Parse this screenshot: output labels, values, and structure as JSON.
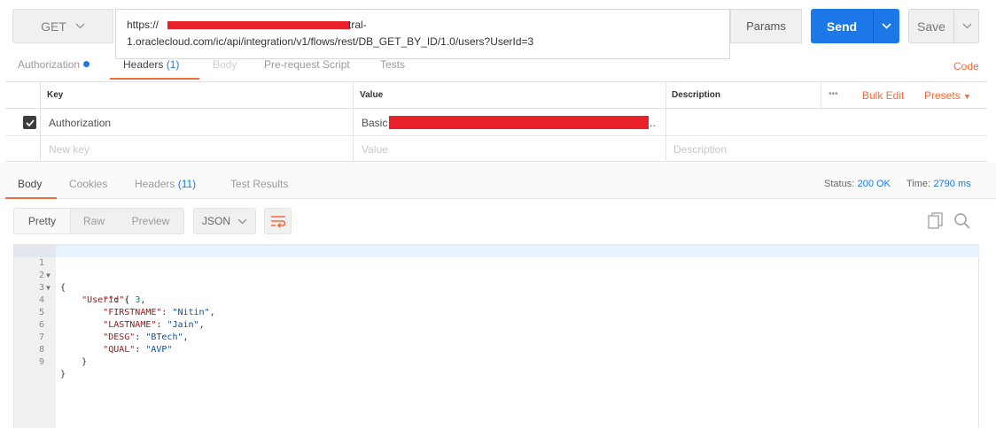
{
  "request": {
    "method": "GET",
    "url_line1_prefix": "https://",
    "url_line1_suffix": "tral-",
    "url_line2": "1.oraclecloud.com/ic/api/integration/v1/flows/rest/DB_GET_BY_ID/1.0/users?UserId=3",
    "params_label": "Params",
    "send_label": "Send",
    "save_label": "Save"
  },
  "request_tabs": {
    "authorization": "Authorization",
    "headers": "Headers",
    "headers_count": "(1)",
    "body": "Body",
    "prerequest": "Pre-request Script",
    "tests": "Tests",
    "code": "Code"
  },
  "headers_table": {
    "col_key": "Key",
    "col_value": "Value",
    "col_description": "Description",
    "more": "•••",
    "bulk_edit": "Bulk Edit",
    "presets": "Presets",
    "rows": [
      {
        "key": "Authorization",
        "value_prefix": "Basic",
        "value_suffix": "..",
        "description": ""
      }
    ],
    "placeholder_key": "New key",
    "placeholder_value": "Value",
    "placeholder_description": "Description"
  },
  "response_tabs": {
    "body": "Body",
    "cookies": "Cookies",
    "headers": "Headers",
    "headers_count": "(11)",
    "test_results": "Test Results",
    "status_label": "Status:",
    "status_value": "200 OK",
    "time_label": "Time:",
    "time_value": "2790 ms"
  },
  "response_toolbar": {
    "pretty": "Pretty",
    "raw": "Raw",
    "preview": "Preview",
    "format": "JSON"
  },
  "response_body": {
    "line_numbers": [
      "1",
      "2",
      "3",
      "4",
      "5",
      "6",
      "7",
      "8",
      "9"
    ],
    "line1": "{",
    "user_key": "\"User\"",
    "id_key": "\"id\"",
    "id_value": "3",
    "firstname_key": "\"FIRSTNAME\"",
    "firstname_value": "\"Nitin\"",
    "lastname_key": "\"LASTNAME\"",
    "lastname_value": "\"Jain\"",
    "desg_key": "\"DESG\"",
    "desg_value": "\"BTech\"",
    "qual_key": "\"QUAL\"",
    "qual_value": "\"AVP\"",
    "line8": "}",
    "line9": "}"
  },
  "colors": {
    "accent_orange": "#f26b3a",
    "send_blue": "#1c78e6",
    "redaction_red": "#e8202a"
  }
}
